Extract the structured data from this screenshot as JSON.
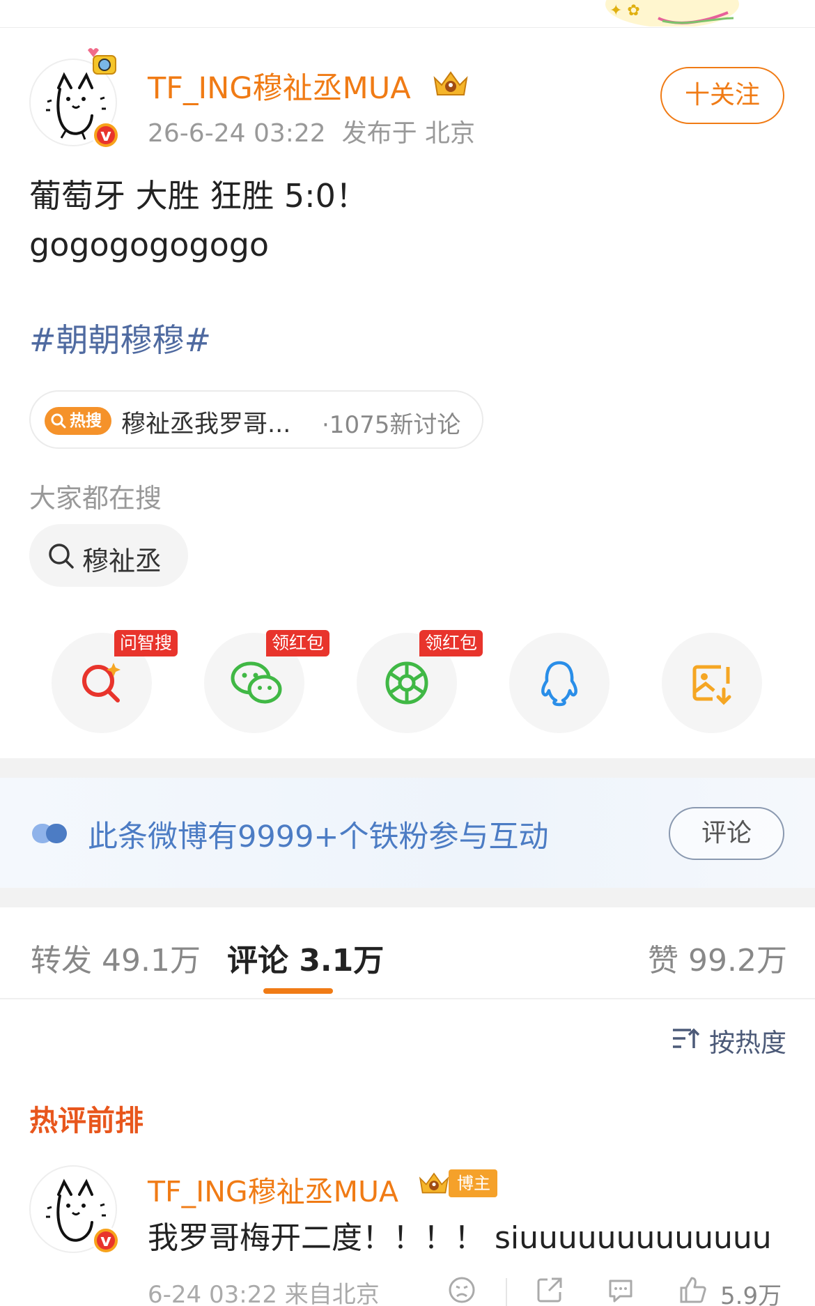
{
  "colors": {
    "accent": "#f07b15",
    "hashtag": "#4f6aa0",
    "hot": "#e8561c",
    "badge_red": "#e8342c",
    "fan_text": "#4c7cc4"
  },
  "post": {
    "author": "TF_ING穆祉丞MUA",
    "timestamp": "26-6-24 03:22",
    "location": "发布于 北京",
    "follow_label": "十关注",
    "text_line1": "葡萄牙 大胜 狂胜 5:0！",
    "text_line2": "gogogogogogo",
    "hashtag": "#朝朝穆穆#"
  },
  "hot_search": {
    "tag": "热搜",
    "title": "穆祉丞我罗哥...",
    "count": "·1075新讨论"
  },
  "everyone_search": {
    "label": "大家都在搜",
    "query": "穆祉丞"
  },
  "share": [
    {
      "icon": "ai-search-icon",
      "tag": "问智搜"
    },
    {
      "icon": "wechat-icon",
      "tag": "领红包"
    },
    {
      "icon": "moments-icon",
      "tag": "领红包"
    },
    {
      "icon": "qq-icon",
      "tag": ""
    },
    {
      "icon": "save-image-icon",
      "tag": ""
    }
  ],
  "fan_banner": {
    "text": "此条微博有9999+个铁粉参与互动",
    "button": "评论"
  },
  "tabs": {
    "repost": "转发 49.1万",
    "comment": "评论 3.1万",
    "like": "赞 99.2万",
    "active": "comment"
  },
  "sort_label": "按热度",
  "hot_comments_title": "热评前排",
  "comment": {
    "author": "TF_ING穆祉丞MUA",
    "badge": "博主",
    "text": "我罗哥梅开二度！！！！ siuuuuuuuuuuuuu",
    "meta": "6-24 03:22 来自北京",
    "likes": "5.9万"
  }
}
